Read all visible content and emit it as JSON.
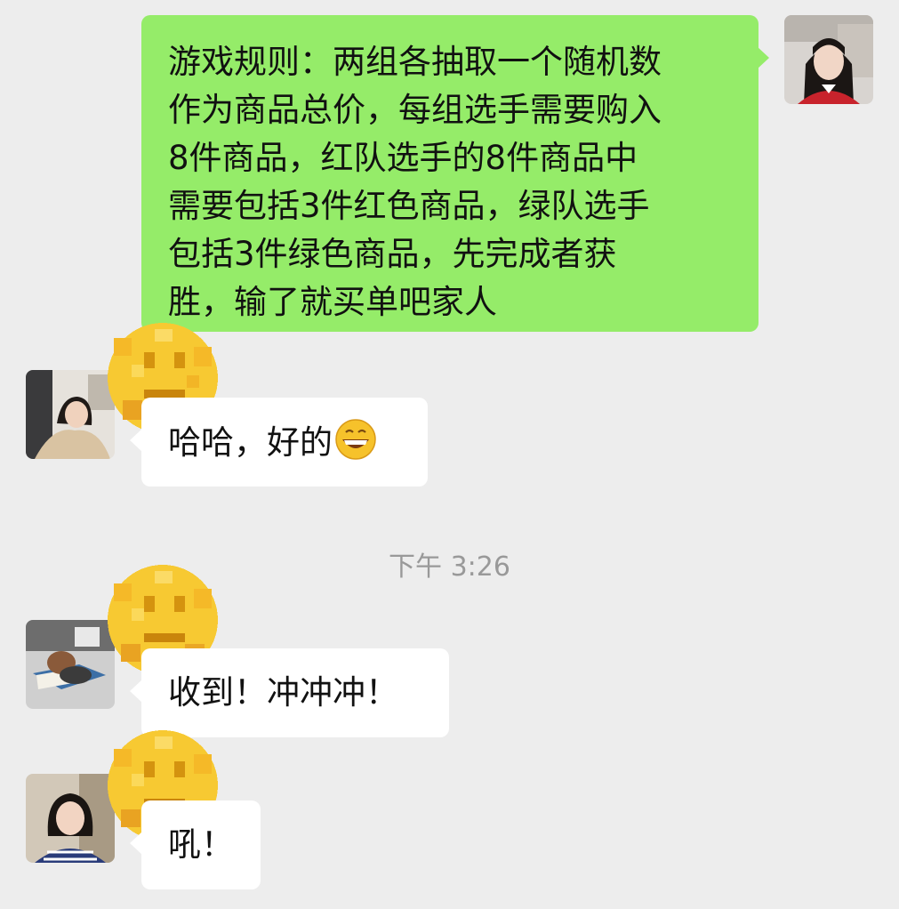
{
  "messages": [
    {
      "sender": "self",
      "text": "游戏规则：两组各抽取一个随机数作为商品总价，每组选手需要购入8件商品，红队选手的8件商品中需要包括3件红色商品，绿队选手包括3件绿色商品，先完成者获胜，输了就买单吧家人",
      "lines": [
        "游戏规则：两组各抽取一个随机数",
        "作为商品总价，每组选手需要购入",
        "8件商品，红队选手的8件商品中",
        "需要包括3件红色商品，绿队选手",
        "包括3件绿色商品，先完成者获",
        "胜，输了就买单吧家人"
      ]
    },
    {
      "sender": "member-1",
      "text": "哈哈，好的",
      "emoji": "grin-emoji"
    },
    {
      "sender": "member-2",
      "text": "收到！冲冲冲！"
    },
    {
      "sender": "member-3",
      "text": "吼！"
    }
  ],
  "timestamp": "下午 3:26",
  "colors": {
    "background": "#ededed",
    "self_bubble": "#95ec69",
    "other_bubble": "#ffffff",
    "timestamp": "#999999"
  },
  "icons": {
    "name_mosaic": "pixelated-face-icon",
    "emoji": "grin-emoji"
  }
}
